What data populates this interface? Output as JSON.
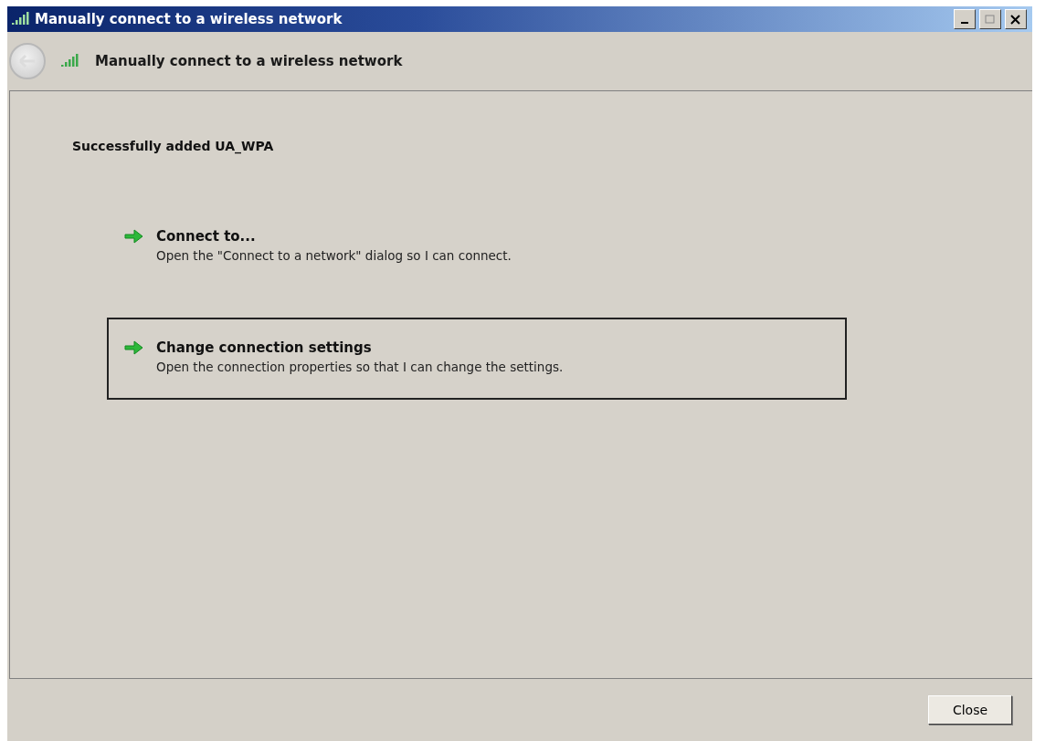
{
  "window": {
    "title": "Manually connect to a wireless network"
  },
  "header": {
    "title": "Manually connect to a wireless network"
  },
  "message": "Successfully added UA_WPA",
  "options": [
    {
      "title": "Connect to...",
      "description": "Open the \"Connect to a network\" dialog so I can connect.",
      "selected": false
    },
    {
      "title": "Change connection settings",
      "description": "Open the connection properties so that I can change the settings.",
      "selected": true
    }
  ],
  "buttons": [
    "Close"
  ]
}
